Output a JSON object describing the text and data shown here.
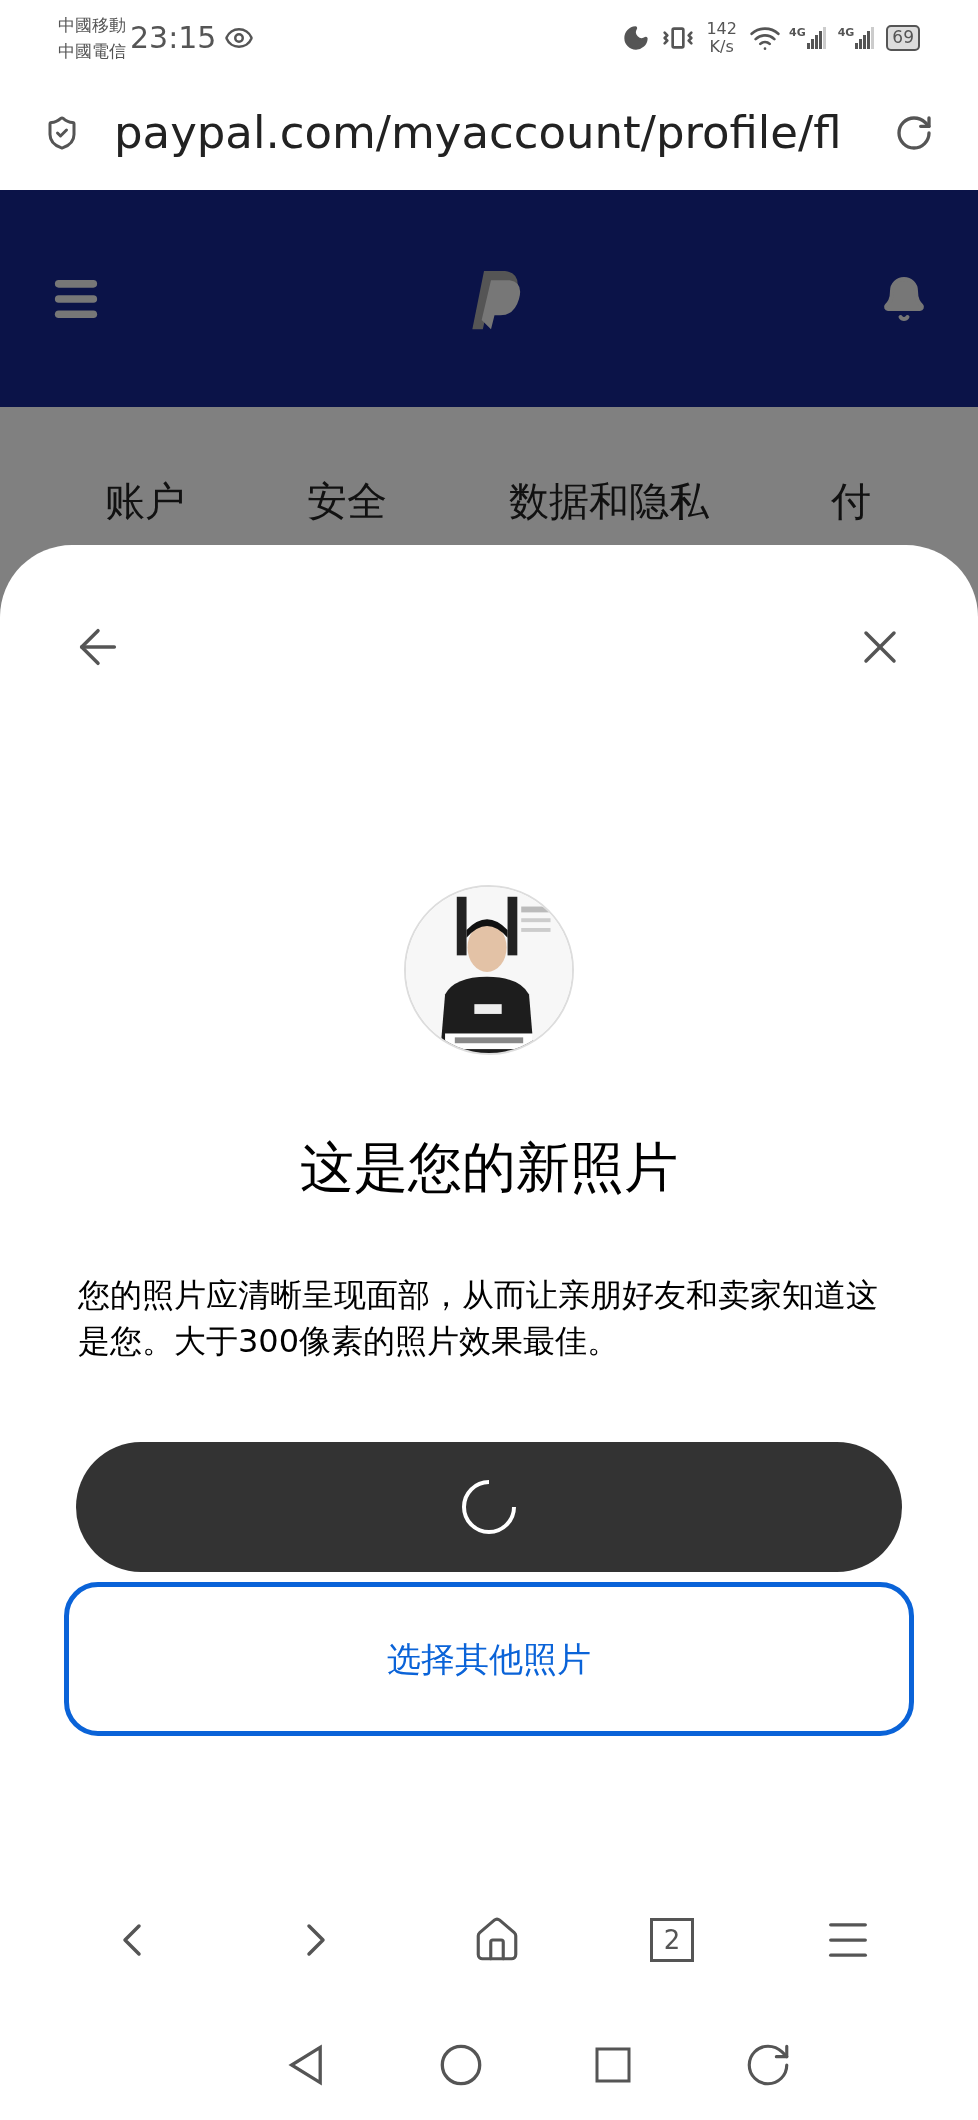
{
  "status_bar": {
    "carriers": [
      "中國移動",
      "中國電信"
    ],
    "time": "23:15",
    "speed": [
      "142",
      "K/s"
    ],
    "network": [
      "4G",
      "4G"
    ],
    "battery": "69"
  },
  "address_bar": {
    "url": "paypal.com/myaccount/profile/fl"
  },
  "tabs": [
    {
      "label": "账户"
    },
    {
      "label": "安全"
    },
    {
      "label": "数据和隐私"
    },
    {
      "label": "付"
    }
  ],
  "dialog": {
    "title": "这是您的新照片",
    "body": "您的照片应清晰呈现面部，从而让亲朋好友和卖家知道这是您。大于300像素的照片效果最佳。",
    "save_button": {
      "loading": true
    },
    "other_button": "选择其他照片"
  },
  "browser_bar": {
    "tab_count": "2"
  }
}
